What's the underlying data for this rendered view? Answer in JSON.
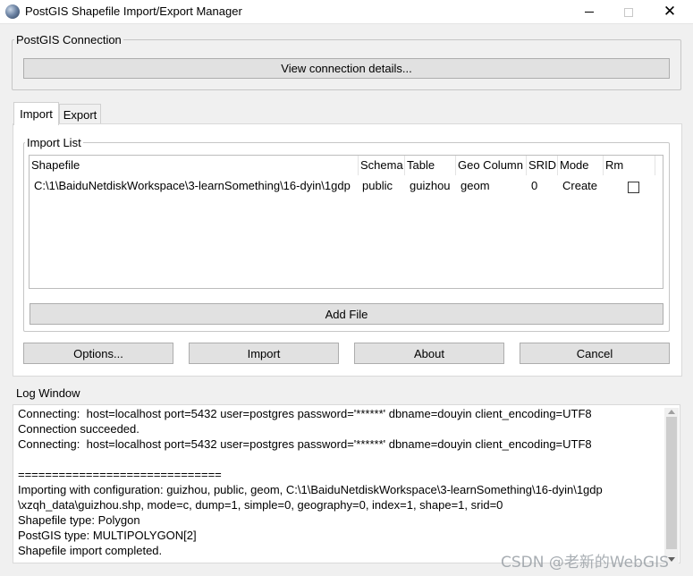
{
  "window": {
    "title": "PostGIS Shapefile Import/Export Manager",
    "close_glyph": "✕"
  },
  "connection": {
    "group_label": "PostGIS Connection",
    "view_details_button": "View connection details..."
  },
  "tabs": [
    {
      "label": "Import",
      "active": true
    },
    {
      "label": "Export",
      "active": false
    }
  ],
  "import_list": {
    "group_label": "Import List",
    "columns": [
      "Shapefile",
      "Schema",
      "Table",
      "Geo Column",
      "SRID",
      "Mode",
      "Rm"
    ],
    "rows": [
      {
        "shapefile": "C:\\1\\BaiduNetdiskWorkspace\\3-learnSomething\\16-dyin\\1gdp",
        "schema": "public",
        "table": "guizhou",
        "geo_column": "geom",
        "srid": "0",
        "mode": "Create",
        "rm": false
      }
    ],
    "add_file_button": "Add File"
  },
  "actions": {
    "options": "Options...",
    "import": "Import",
    "about": "About",
    "cancel": "Cancel"
  },
  "log": {
    "group_label": "Log Window",
    "lines": [
      "Connecting:  host=localhost port=5432 user=postgres password='******' dbname=douyin client_encoding=UTF8",
      "Connection succeeded.",
      "Connecting:  host=localhost port=5432 user=postgres password='******' dbname=douyin client_encoding=UTF8",
      "",
      "==============================",
      "Importing with configuration: guizhou, public, geom, C:\\1\\BaiduNetdiskWorkspace\\3-learnSomething\\16-dyin\\1gdp",
      "\\xzqh_data\\guizhou.shp, mode=c, dump=1, simple=0, geography=0, index=1, shape=1, srid=0",
      "Shapefile type: Polygon",
      "PostGIS type: MULTIPOLYGON[2]",
      "Shapefile import completed."
    ]
  },
  "watermark": "CSDN @老新的WebGIS"
}
